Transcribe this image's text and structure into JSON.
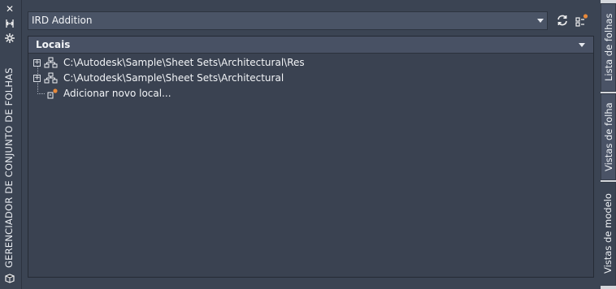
{
  "sidebar": {
    "title": "GERENCIADOR DE CONJUNTO DE FOLHAS",
    "icons": [
      "close-icon",
      "auto-hide-icon",
      "properties-icon",
      "sheet-set-icon"
    ]
  },
  "toolbar": {
    "sheet_set_selected": "IRD Addition",
    "refresh_icon": "refresh-icon",
    "options_icon": "options-icon"
  },
  "panel": {
    "header_label": "Locais",
    "items": [
      {
        "label": "C:\\Autodesk\\Sample\\Sheet Sets\\Architectural\\Res",
        "expandable": true
      },
      {
        "label": "C:\\Autodesk\\Sample\\Sheet Sets\\Architectural",
        "expandable": true
      },
      {
        "label": "Adicionar novo local...",
        "expandable": false
      }
    ]
  },
  "tabs": [
    {
      "label": "Lista de folhas",
      "active": false
    },
    {
      "label": "Vistas de folha",
      "active": false
    },
    {
      "label": "Vistas de modelo",
      "active": true
    }
  ],
  "colors": {
    "panel_bg": "#3b4453",
    "content_bg": "#3a4251",
    "header_bg": "#485164",
    "text": "#f2f4f7",
    "accent_orange": "#e8893a"
  }
}
